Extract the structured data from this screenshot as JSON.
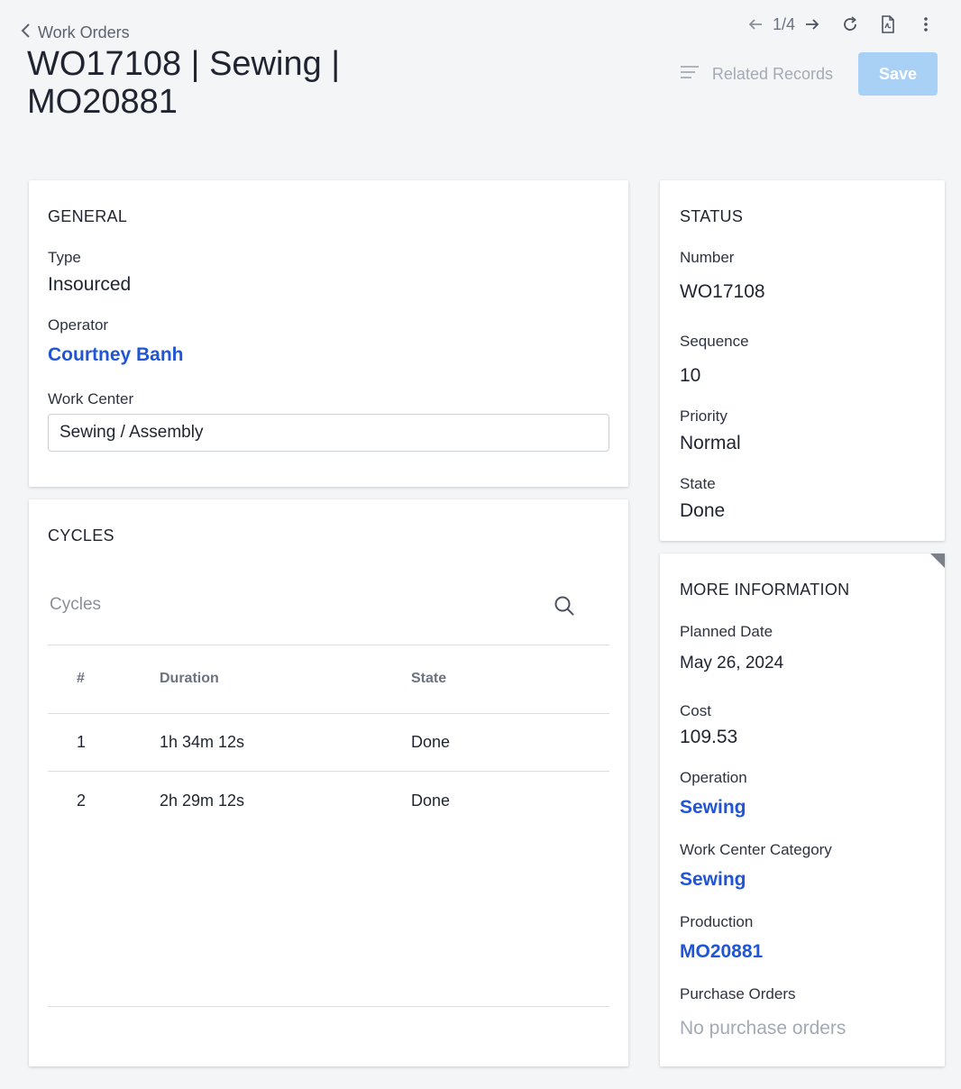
{
  "header": {
    "back_label": "Work Orders",
    "title": "WO17108 | Sewing | MO20881",
    "pager": "1/4",
    "related_records_label": "Related Records",
    "save_label": "Save"
  },
  "general": {
    "title": "GENERAL",
    "type_label": "Type",
    "type_value": "Insourced",
    "operator_label": "Operator",
    "operator_value": "Courtney Banh",
    "work_center_label": "Work Center",
    "work_center_value": "Sewing / Assembly"
  },
  "cycles": {
    "title": "CYCLES",
    "search_placeholder": "Cycles",
    "columns": [
      "#",
      "Duration",
      "State"
    ],
    "rows": [
      {
        "num": "1",
        "duration": "1h 34m 12s",
        "state": "Done"
      },
      {
        "num": "2",
        "duration": "2h 29m 12s",
        "state": "Done"
      }
    ]
  },
  "status": {
    "title": "STATUS",
    "number_label": "Number",
    "number_value": "WO17108",
    "sequence_label": "Sequence",
    "sequence_value": "10",
    "priority_label": "Priority",
    "priority_value": "Normal",
    "state_label": "State",
    "state_value": "Done"
  },
  "more_info": {
    "title": "MORE INFORMATION",
    "planned_date_label": "Planned Date",
    "planned_date_value": "May 26, 2024",
    "cost_label": "Cost",
    "cost_value": "109.53",
    "operation_label": "Operation",
    "operation_value": "Sewing",
    "wc_category_label": "Work Center Category",
    "wc_category_value": "Sewing",
    "production_label": "Production",
    "production_value": "MO20881",
    "purchase_orders_label": "Purchase Orders",
    "purchase_orders_value": "No purchase orders"
  },
  "icons": {
    "back": "chevron-left-icon",
    "prev": "arrow-left-icon",
    "next": "arrow-right-icon",
    "refresh": "refresh-icon",
    "pdf": "pdf-icon",
    "more": "kebab-menu-icon",
    "related": "list-icon",
    "search": "search-icon"
  },
  "colors": {
    "link": "#1f55d6",
    "save_bg": "#a8d1f5",
    "background": "#f4f5f7"
  }
}
